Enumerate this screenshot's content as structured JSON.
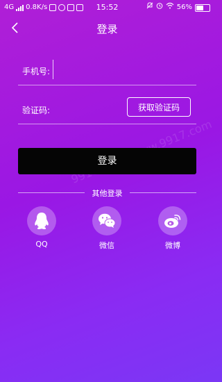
{
  "status_bar": {
    "network": "4G",
    "speed": "0.8K/s",
    "time": "15:52",
    "battery": "56%"
  },
  "nav": {
    "title": "登录"
  },
  "form": {
    "phone_label": "手机号:",
    "phone_value": "",
    "code_label": "验证码:",
    "code_value": "",
    "get_code_label": "获取验证码",
    "login_label": "登录"
  },
  "other_login": {
    "title": "其他登录",
    "items": [
      {
        "label": "QQ",
        "icon": "qq-icon"
      },
      {
        "label": "微信",
        "icon": "wechat-icon"
      },
      {
        "label": "微博",
        "icon": "weibo-icon"
      }
    ]
  },
  "watermark": "9917下载站 www.9917.com",
  "colors": {
    "gradient_start": "#b01fd6",
    "gradient_end": "#7b37f5",
    "button_bg": "#050505"
  }
}
